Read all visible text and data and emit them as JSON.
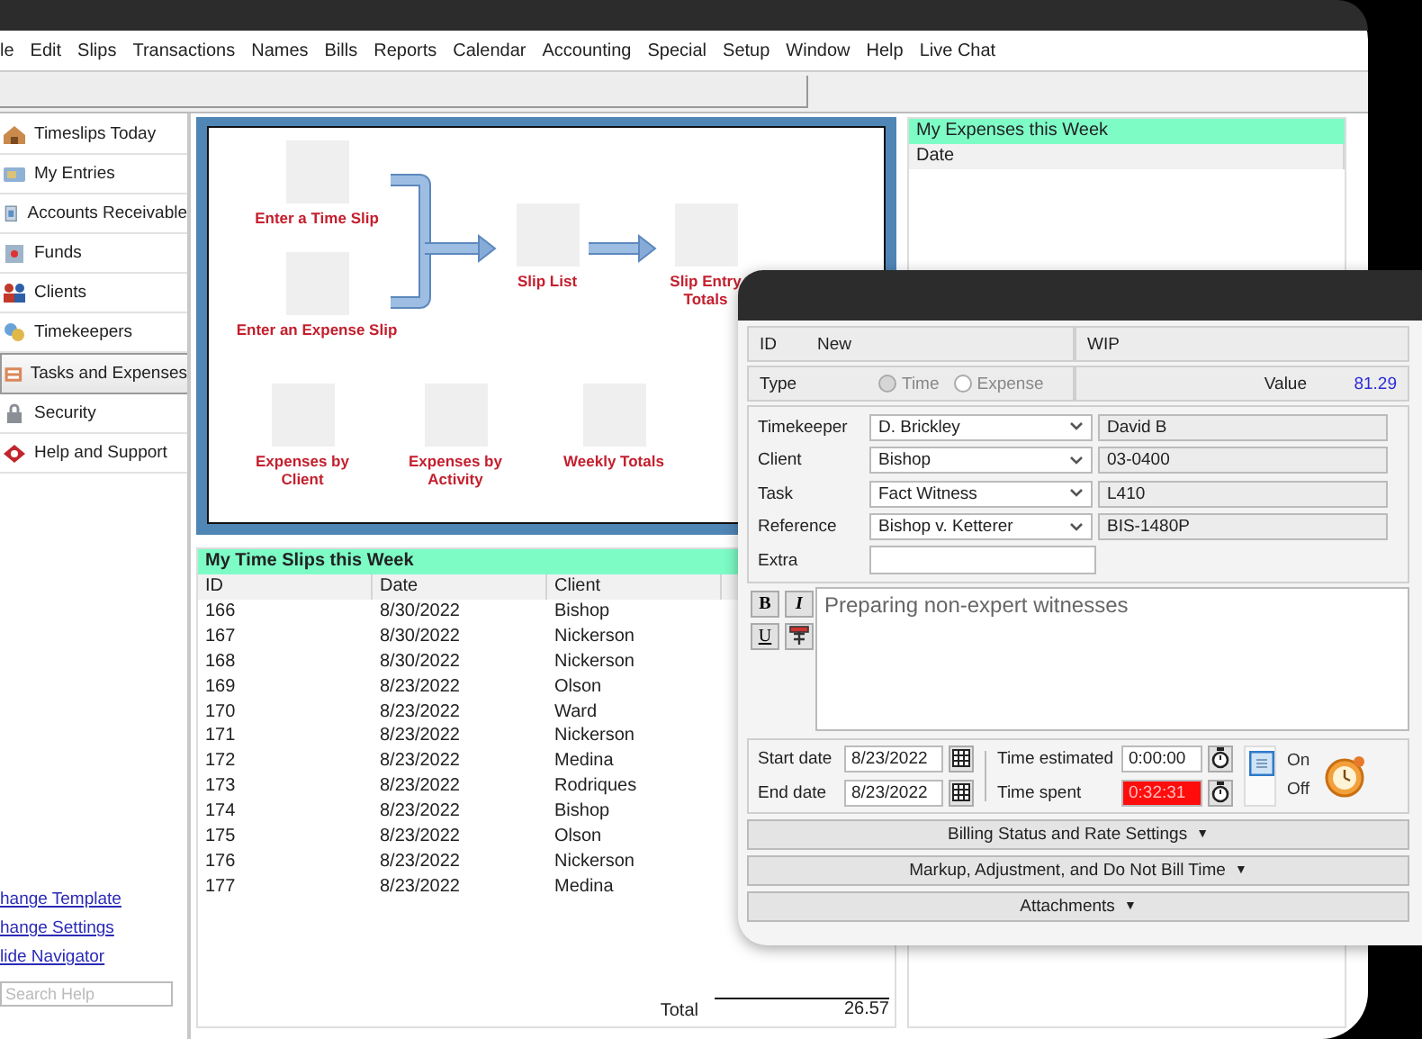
{
  "menu": [
    "le",
    "Edit",
    "Slips",
    "Transactions",
    "Names",
    "Bills",
    "Reports",
    "Calendar",
    "Accounting",
    "Special",
    "Setup",
    "Window",
    "Help",
    "Live Chat"
  ],
  "sidebar": {
    "items": [
      {
        "label": "Timeslips Today",
        "selected": false
      },
      {
        "label": "My Entries",
        "selected": false
      },
      {
        "label": "Accounts Receivable",
        "selected": false
      },
      {
        "label": "Funds",
        "selected": false
      },
      {
        "label": "Clients",
        "selected": false
      },
      {
        "label": "Timekeepers",
        "selected": false
      },
      {
        "label": "Tasks and Expenses",
        "selected": true
      },
      {
        "label": "Security",
        "selected": false
      },
      {
        "label": "Help and Support",
        "selected": false
      }
    ],
    "links": [
      "hange Template",
      "hange Settings",
      "lide Navigator"
    ],
    "search": {
      "placeholder": "Search Help"
    }
  },
  "flowchart": {
    "nodes": [
      {
        "label": "Enter a Time Slip"
      },
      {
        "label": "Enter an Expense Slip"
      },
      {
        "label": "Slip List"
      },
      {
        "label": "Slip Entry Totals"
      },
      {
        "label": "Expenses by Client"
      },
      {
        "label": "Expenses by Activity"
      },
      {
        "label": "Weekly Totals"
      }
    ]
  },
  "time_slips": {
    "title": "My Time Slips this Week",
    "columns": [
      "ID",
      "Date",
      "Client"
    ],
    "rows": [
      [
        "166",
        "8/30/2022",
        "Bishop"
      ],
      [
        "167",
        "8/30/2022",
        "Nickerson"
      ],
      [
        "168",
        "8/30/2022",
        "Nickerson"
      ],
      [
        "169",
        "8/23/2022",
        "Olson"
      ],
      [
        "170",
        "8/23/2022",
        "Ward"
      ],
      [
        "171",
        "8/23/2022",
        "Nickerson"
      ],
      [
        "172",
        "8/23/2022",
        "Medina"
      ],
      [
        "173",
        "8/23/2022",
        "Rodriques"
      ],
      [
        "174",
        "8/23/2022",
        "Bishop"
      ],
      [
        "175",
        "8/23/2022",
        "Olson"
      ],
      [
        "176",
        "8/23/2022",
        "Nickerson"
      ],
      [
        "177",
        "8/23/2022",
        "Medina"
      ]
    ],
    "total_label": "Total",
    "total": "26.57"
  },
  "expenses": {
    "title": "My Expenses this Week",
    "columns": [
      "Date"
    ]
  },
  "slip_dialog": {
    "id_label": "ID",
    "id_value": "New",
    "wip_label": "WIP",
    "type_label": "Type",
    "type_options": [
      {
        "label": "Time",
        "selected": true
      },
      {
        "label": "Expense",
        "selected": false
      }
    ],
    "value_label": "Value",
    "value": "81.29",
    "fields": [
      {
        "kind": "dropdown",
        "label": "Timekeeper",
        "value": "D. Brickley",
        "code": "David B"
      },
      {
        "kind": "dropdown",
        "label": "Client",
        "value": "Bishop",
        "code": "03-0400"
      },
      {
        "kind": "dropdown",
        "label": "Task",
        "value": "Fact Witness",
        "code": "L410"
      },
      {
        "kind": "dropdown",
        "label": "Reference",
        "value": "Bishop v. Ketterer",
        "code": "BIS-1480P"
      },
      {
        "kind": "text",
        "label": "Extra"
      }
    ],
    "format_buttons": [
      "B",
      "I",
      "U"
    ],
    "description": "Preparing non-expert witnesses",
    "start_date_label": "Start date",
    "start_date": "8/23/2022",
    "end_date_label": "End date",
    "end_date": "8/23/2022",
    "time_estimated_label": "Time estimated",
    "time_estimated": "0:00:00",
    "time_spent_label": "Time spent",
    "time_spent": "0:32:31",
    "time_spent_alert": true,
    "timer_on": true,
    "on_label": "On",
    "off_label": "Off",
    "sections": [
      {
        "label": "Billing Status and Rate Settings",
        "caret": "▼",
        "expanded": false
      },
      {
        "label": "Markup, Adjustment, and Do Not Bill Time",
        "caret": "▼",
        "expanded": false
      },
      {
        "label": "Attachments",
        "caret": "▼",
        "expanded": false
      }
    ]
  }
}
